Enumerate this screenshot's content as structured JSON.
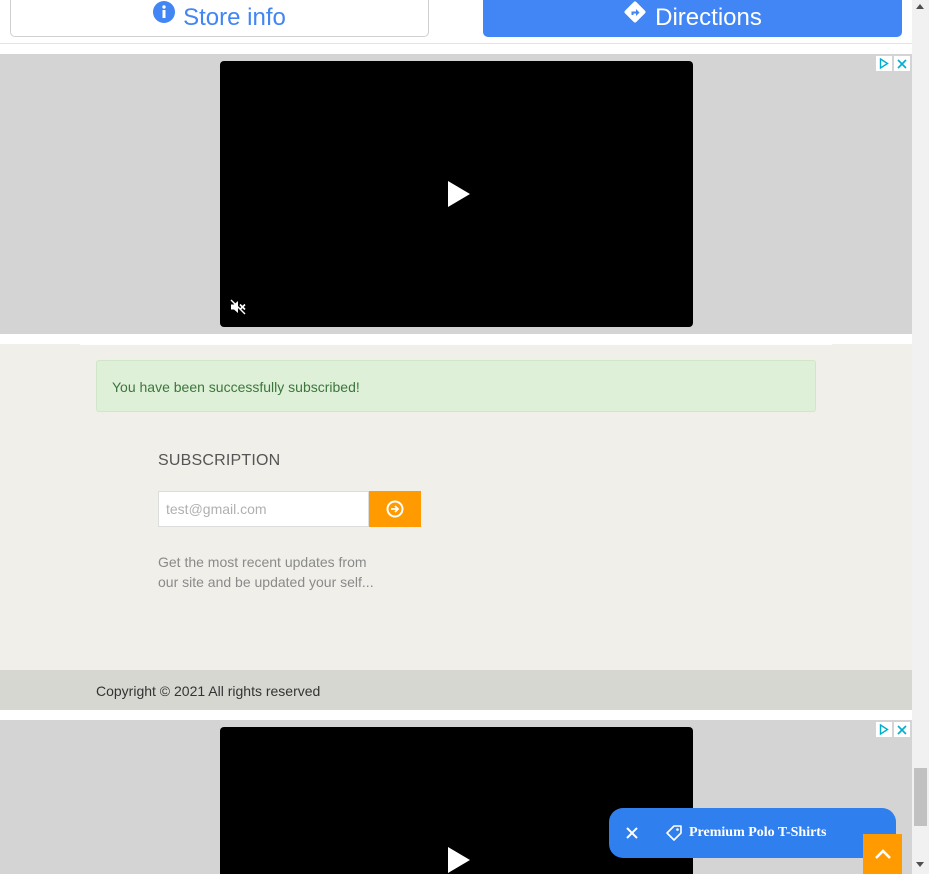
{
  "topbar": {
    "store_info_label": "Store info",
    "directions_label": "Directions"
  },
  "footer": {
    "alert_text": "You have been successfully subscribed!",
    "subscription_title": "SUBSCRIPTION",
    "email_placeholder": "test@gmail.com",
    "description": "Get the most recent updates from our site and be updated your self...",
    "copyright": "Copyright © 2021 All rights reserved"
  },
  "promo": {
    "label": "Premium Polo T-Shirts"
  },
  "colors": {
    "google_blue": "#4285f4",
    "accent_orange": "#ff9a00",
    "promo_blue": "#2f7fef",
    "alert_green_bg": "#dff0d8",
    "alert_green_text": "#3c763d"
  },
  "icons": [
    "info-icon",
    "directions-icon",
    "adchoices-icon",
    "close-icon",
    "play-icon",
    "mute-icon",
    "arrow-circle-right-icon",
    "tag-icon",
    "chevron-up-icon"
  ]
}
